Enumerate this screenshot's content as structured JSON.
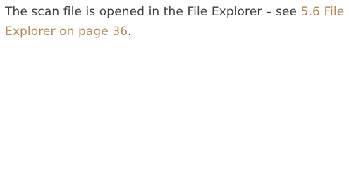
{
  "document": {
    "paragraph_start": "The scan file is opened in the File Explorer – see ",
    "link_text": "5.6 File Explorer on page 36",
    "paragraph_end": ".",
    "link_color": "#b38a52",
    "text_color": "#3f3f3f"
  }
}
